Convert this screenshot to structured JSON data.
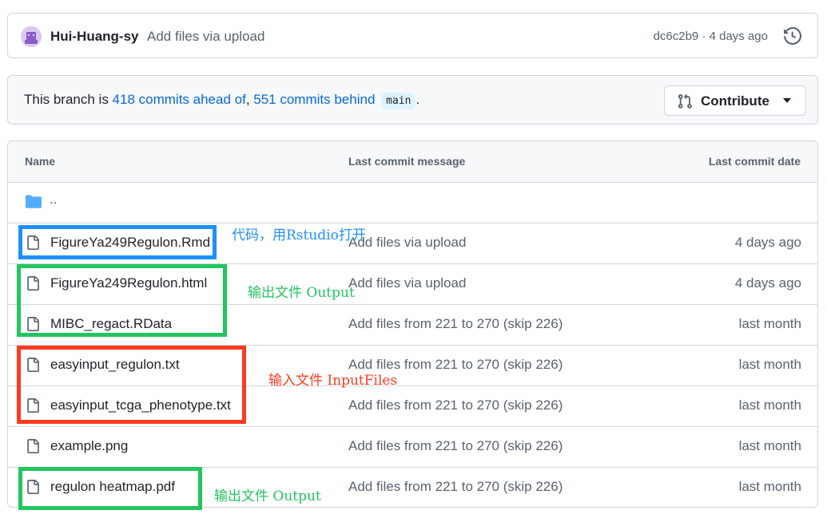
{
  "commit": {
    "author": "Hui-Huang-sy",
    "message": "Add files via upload",
    "meta": "dc6c2b9 · 4 days ago"
  },
  "branch": {
    "prefix": "This branch is ",
    "ahead": "418 commits ahead of",
    "separator": ", ",
    "behind": "551 commits behind",
    "base": "main",
    "suffix": ".",
    "contribute_label": "Contribute"
  },
  "table": {
    "headers": {
      "name": "Name",
      "message": "Last commit message",
      "date": "Last commit date"
    },
    "parent": "..",
    "rows": [
      {
        "name": "FigureYa249Regulon.Rmd",
        "message": "Add files via upload",
        "date": "4 days ago"
      },
      {
        "name": "FigureYa249Regulon.html",
        "message": "Add files via upload",
        "date": "4 days ago"
      },
      {
        "name": "MIBC_regact.RData",
        "message": "Add files from 221 to 270 (skip 226)",
        "date": "last month"
      },
      {
        "name": "easyinput_regulon.txt",
        "message": "Add files from 221 to 270 (skip 226)",
        "date": "last month"
      },
      {
        "name": "easyinput_tcga_phenotype.txt",
        "message": "Add files from 221 to 270 (skip 226)",
        "date": "last month"
      },
      {
        "name": "example.png",
        "message": "Add files from 221 to 270 (skip 226)",
        "date": "last month"
      },
      {
        "name": "regulon heatmap.pdf",
        "message": "Add files from 221 to 270 (skip 226)",
        "date": "last month"
      }
    ]
  },
  "annotations": {
    "code": "代码，用Rstudio打开",
    "output1": "输出文件 Output",
    "input": "输入文件 InputFiles",
    "output2": "输出文件 Output"
  },
  "colors": {
    "link": "#0969da",
    "folder": "#54aeff",
    "annotation_blue": "#1e90ff",
    "annotation_green": "#22c55e",
    "annotation_red": "#ff3b1f"
  },
  "icons": {
    "history": "history-icon",
    "contribute": "git-pull-request-icon",
    "folder": "folder-icon",
    "file": "file-icon"
  }
}
